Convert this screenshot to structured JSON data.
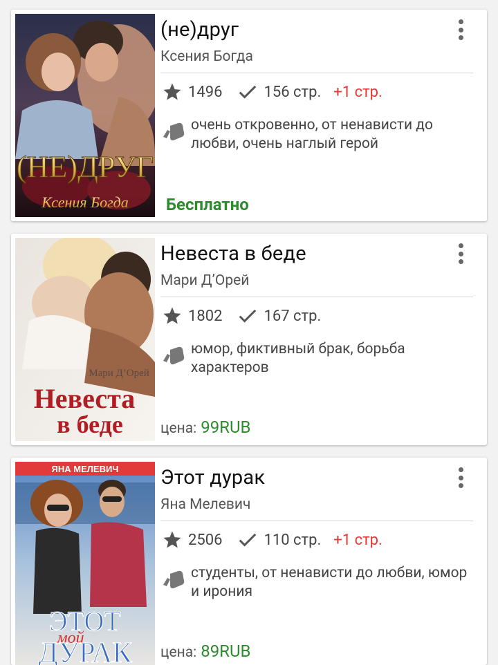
{
  "books": [
    {
      "title": "(не)друг",
      "author": "Ксения Богда",
      "rating": "1496",
      "pages": "156 стр.",
      "bonus": "+1 стр.",
      "tags": "очень откровенно, от ненависти до любви, очень наглый герой",
      "price_text": "Бесплатно",
      "cover": {
        "title": "(НЕ)ДРУГ",
        "author": "Ксения Богда"
      }
    },
    {
      "title": "Невеста в беде",
      "author": "Мари Д’Орей",
      "rating": "1802",
      "pages": "167 стр.",
      "tags": "юмор, фиктивный брак, борьба характеров",
      "price_label": "цена:",
      "price_value": "99RUB",
      "cover": {
        "author": "Мари Д’Орей",
        "title_line1": "Невеста",
        "title_line2": "в беде"
      }
    },
    {
      "title": "Этот дурак",
      "author": "Яна Мелевич",
      "rating": "2506",
      "pages": "110 стр.",
      "bonus": "+1 стр.",
      "tags": "студенты, от ненависти до любви, юмор и ирония",
      "price_label": "цена:",
      "price_value": "89RUB",
      "cover": {
        "author": "ЯНА МЕЛЕВИЧ",
        "title_line1": "ЭТОТ",
        "title_line2": "ДУРАК",
        "overlay": "мой"
      }
    }
  ]
}
